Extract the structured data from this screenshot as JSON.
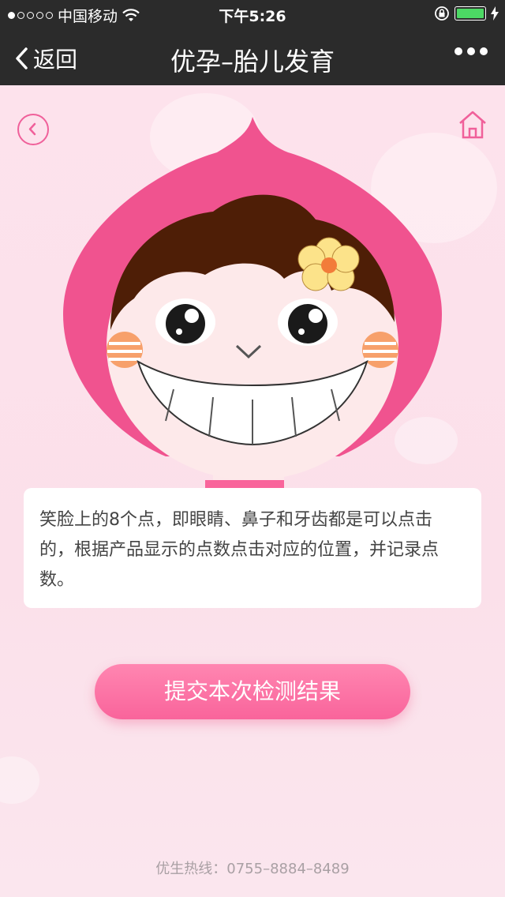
{
  "status_bar": {
    "carrier": "中国移动",
    "time": "下午5:26"
  },
  "nav": {
    "back_label": "返回",
    "title": "优孕–胎儿发育"
  },
  "content": {
    "instruction": "笑脸上的8个点，即眼睛、鼻子和牙齿都是可以点击的，根据产品显示的点数点击对应的位置，并记录点数。",
    "submit_label": "提交本次检测结果",
    "hotline": "优生热线：0755–8884–8489"
  },
  "colors": {
    "accent": "#f9649b",
    "nav_bg": "#2b2b2b",
    "page_bg": "#fbe3ec"
  },
  "icons": [
    "signal-dots-icon",
    "wifi-icon",
    "lock-rotation-icon",
    "battery-icon",
    "charging-icon",
    "back-chevron-icon",
    "more-dots-icon",
    "circle-back-icon",
    "home-icon"
  ]
}
